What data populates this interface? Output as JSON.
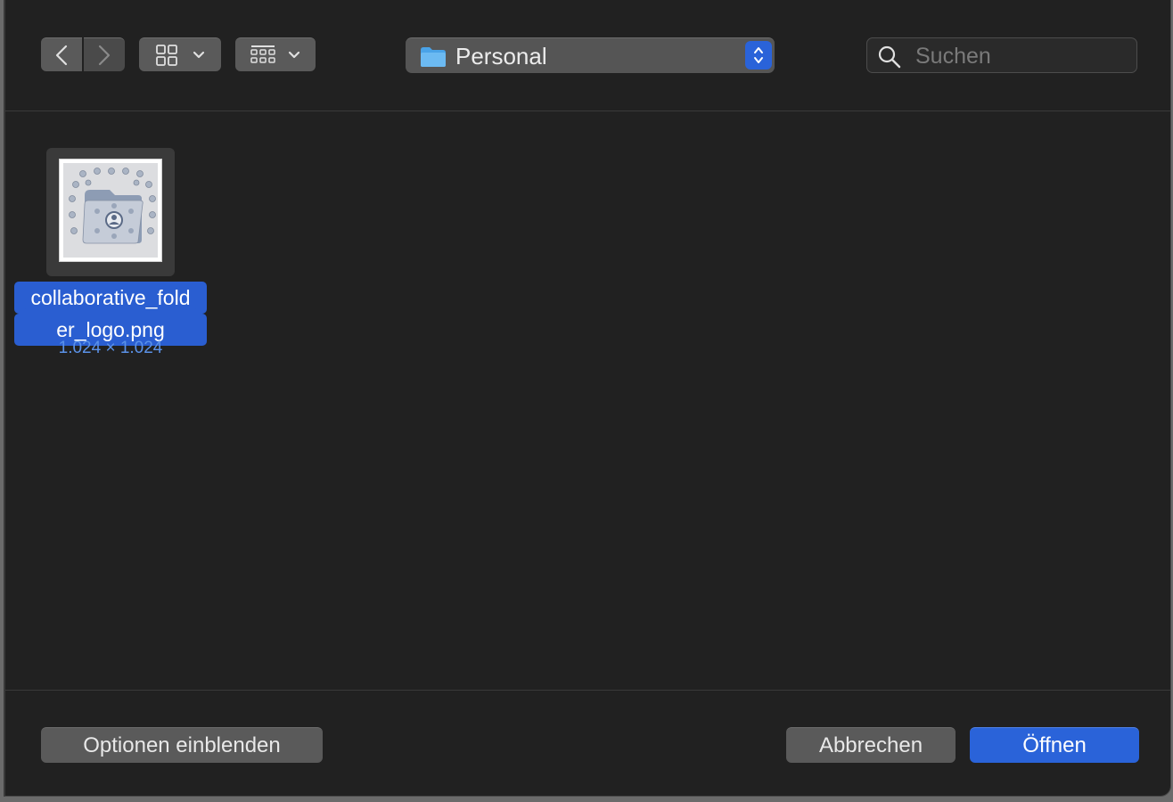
{
  "toolbar": {
    "location_label": "Personal",
    "search_placeholder": "Suchen"
  },
  "file": {
    "name_line1": "collaborative_fold",
    "name_line2": "er_logo.png",
    "dimensions": "1.024 × 1.024"
  },
  "footer": {
    "options_label": "Optionen einblenden",
    "cancel_label": "Abbrechen",
    "open_label": "Öffnen"
  },
  "colors": {
    "accent": "#2a63d9",
    "background": "#212121"
  }
}
